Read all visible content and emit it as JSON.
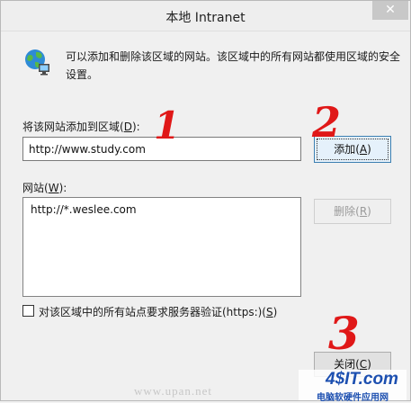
{
  "window": {
    "title": "本地 Intranet",
    "description": "可以添加和删除该区域的网站。该区域中的所有网站都使用区域的安全设置。"
  },
  "add_section": {
    "label_before": "将该网站添加到区域(",
    "label_key": "D",
    "label_after": "):",
    "input_value": "http://www.study.com",
    "add_button_before": "添加(",
    "add_button_key": "A",
    "add_button_after": ")"
  },
  "sites_section": {
    "label_before": "网站(",
    "label_key": "W",
    "label_after": "):",
    "items": [
      "http://*.weslee.com"
    ],
    "remove_button_before": "删除(",
    "remove_button_key": "R",
    "remove_button_after": ")"
  },
  "https_option": {
    "label_before": "对该区域中的所有站点要求服务器验证(https:)(",
    "label_key": "S",
    "label_after": ")",
    "checked": false
  },
  "footer": {
    "close_button_before": "关闭(",
    "close_button_key": "C",
    "close_button_after": ")"
  },
  "annotations": {
    "step1": "1",
    "step2": "2",
    "step3": "3",
    "color": "#e01818"
  },
  "watermarks": {
    "site": "www.upan.net",
    "brand_logo": "4$IT.com",
    "brand_sub": "电脑软硬件应用网"
  },
  "icons": {
    "close": "close-icon",
    "zone": "globe-network-icon"
  }
}
